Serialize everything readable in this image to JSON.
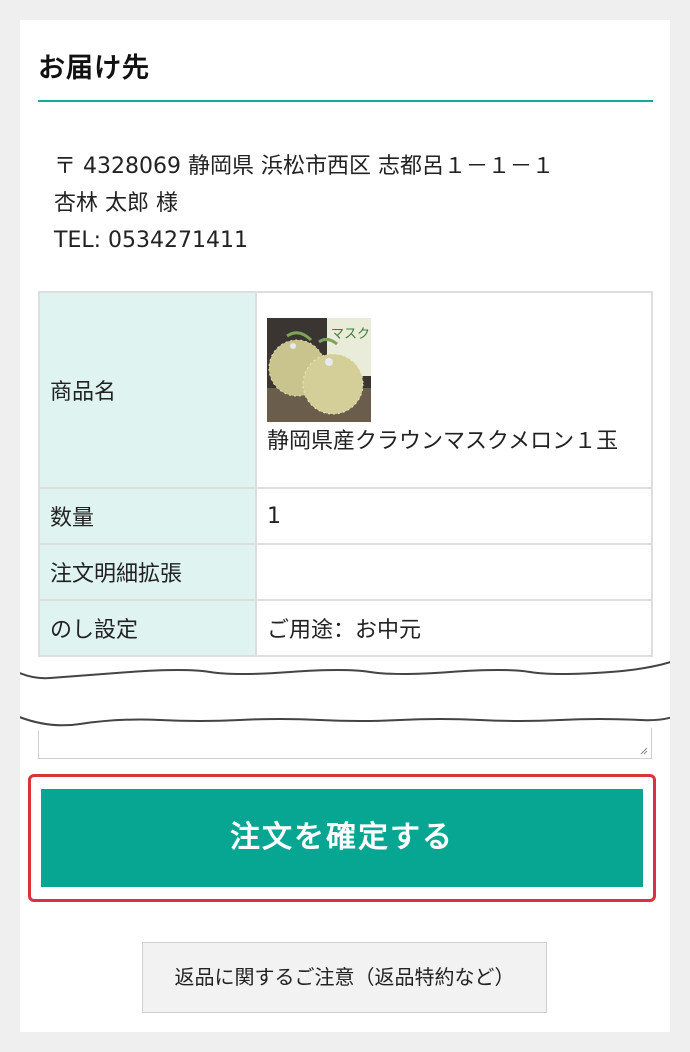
{
  "shipping": {
    "title": "お届け先",
    "address_line": "〒 4328069 静岡県 浜松市西区 志都呂１－１－１",
    "recipient": "杏林 太郎 様",
    "tel": "TEL: 0534271411"
  },
  "order_table": {
    "rows": [
      {
        "label": "商品名",
        "value": "静岡県産クラウンマスクメロン１玉",
        "image_icon": "melon-product-photo",
        "image_text": "マスクメロン"
      },
      {
        "label": "数量",
        "value": "1"
      },
      {
        "label": "注文明細拡張",
        "value": ""
      },
      {
        "label": "のし設定",
        "value": "ご用途：お中元"
      }
    ]
  },
  "actions": {
    "confirm_label": "注文を確定する",
    "return_notice_label": "返品に関するご注意（返品特約など）"
  },
  "colors": {
    "accent": "#07a693",
    "rule": "#18a99a",
    "highlight_border": "#d9333f",
    "label_bg": "#dff3f1"
  }
}
